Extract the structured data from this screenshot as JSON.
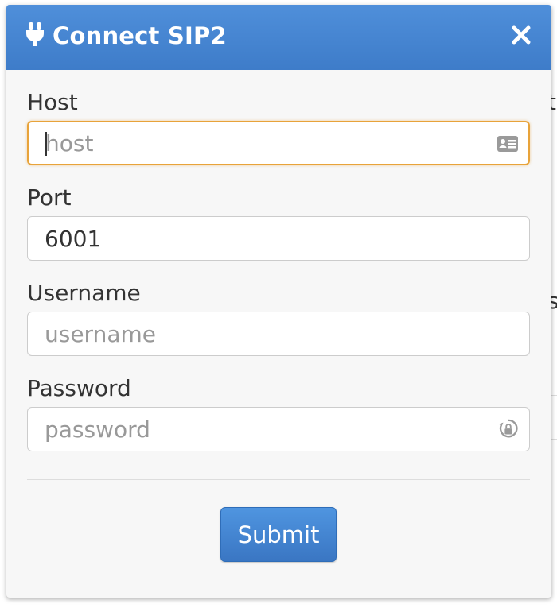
{
  "dialog": {
    "title": "Connect SIP2",
    "accent_color": "#4a87d4",
    "icons": {
      "title_icon": "plug-icon",
      "close_icon": "close-icon"
    }
  },
  "form": {
    "host": {
      "label": "Host",
      "value": "",
      "placeholder": "host",
      "focused": true,
      "icon": "contact-card-icon"
    },
    "port": {
      "label": "Port",
      "value": "6001",
      "placeholder": ""
    },
    "username": {
      "label": "Username",
      "value": "",
      "placeholder": "username"
    },
    "password": {
      "label": "Password",
      "value": "",
      "placeholder": "password",
      "icon": "password-manager-icon"
    }
  },
  "footer": {
    "submit_label": "Submit"
  }
}
